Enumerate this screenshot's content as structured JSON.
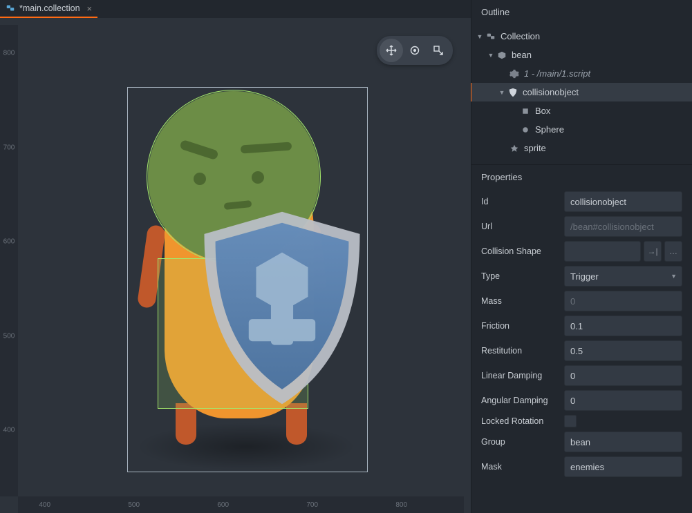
{
  "tab": {
    "title": "*main.collection"
  },
  "ruler": {
    "v": [
      "800",
      "700",
      "600",
      "500",
      "400"
    ],
    "h": [
      "400",
      "500",
      "600",
      "700",
      "800"
    ]
  },
  "toolbar": {
    "move": "move-icon",
    "rotate": "rotate-icon",
    "scale": "scale-icon"
  },
  "outline": {
    "title": "Outline",
    "tree": {
      "collection": "Collection",
      "bean": "bean",
      "script": "1 - /main/1.script",
      "collisionobject": "collisionobject",
      "box": "Box",
      "sphere": "Sphere",
      "sprite": "sprite"
    }
  },
  "properties": {
    "title": "Properties",
    "id": {
      "label": "Id",
      "value": "collisionobject"
    },
    "url": {
      "label": "Url",
      "value": "/bean#collisionobject"
    },
    "collision_shape": {
      "label": "Collision Shape",
      "value": ""
    },
    "type": {
      "label": "Type",
      "value": "Trigger"
    },
    "mass": {
      "label": "Mass",
      "value": "0"
    },
    "friction": {
      "label": "Friction",
      "value": "0.1"
    },
    "restitution": {
      "label": "Restitution",
      "value": "0.5"
    },
    "linear_damping": {
      "label": "Linear Damping",
      "value": "0"
    },
    "angular_damping": {
      "label": "Angular Damping",
      "value": "0"
    },
    "locked_rotation": {
      "label": "Locked Rotation",
      "value": false
    },
    "group": {
      "label": "Group",
      "value": "bean"
    },
    "mask": {
      "label": "Mask",
      "value": "enemies"
    }
  }
}
